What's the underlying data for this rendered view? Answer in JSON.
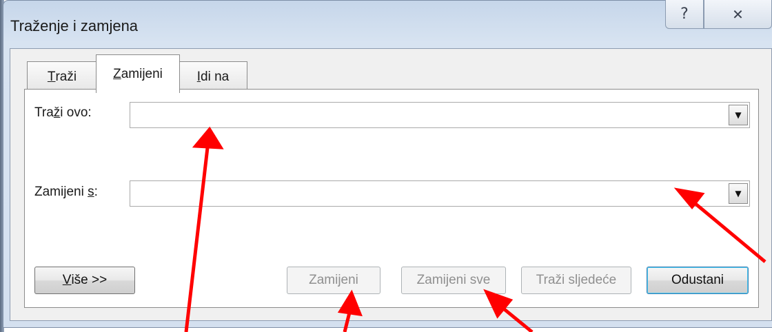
{
  "window": {
    "title": "Traženje i zamjena",
    "help_glyph": "?",
    "close_glyph": "✕"
  },
  "tabs": [
    {
      "label_ul": "T",
      "label_rest": "raži",
      "active": false
    },
    {
      "label_ul": "Z",
      "label_rest": "amijeni",
      "active": true
    },
    {
      "label_ul": "I",
      "label_rest": "di na",
      "active": false
    }
  ],
  "find": {
    "label_pre": "Tra",
    "label_ul": "ž",
    "label_post": "i ovo:",
    "value": ""
  },
  "replace": {
    "label_pre": "Zamijeni ",
    "label_ul": "s",
    "label_post": ":",
    "value": ""
  },
  "buttons": {
    "more_ul": "V",
    "more_rest": "iše >>",
    "replace": "Zamijeni",
    "replace_all": "Zamijeni sve",
    "find_next": "Traži sljedeće",
    "cancel": "Odustani"
  },
  "combo_arrow_glyph": "▼",
  "colors": {
    "annotation_arrow": "#ff0000",
    "disabled_text": "#8f8f8f"
  }
}
